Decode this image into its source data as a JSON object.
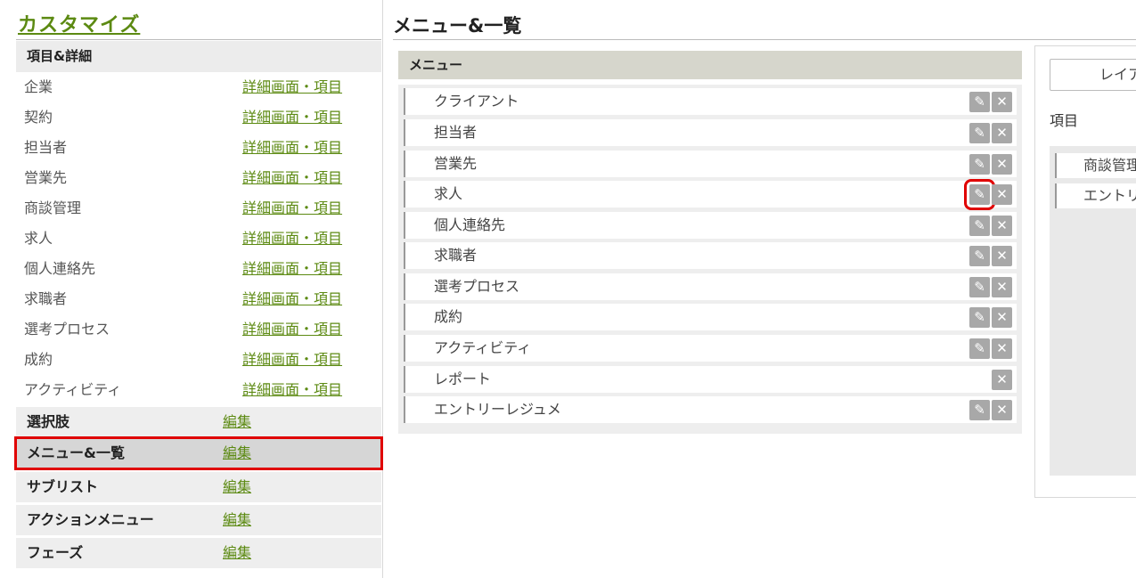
{
  "sidebar": {
    "title": "カスタマイズ",
    "section_items_details": "項目&詳細",
    "items": [
      {
        "label": "企業",
        "link": "詳細画面・項目"
      },
      {
        "label": "契約",
        "link": "詳細画面・項目"
      },
      {
        "label": "担当者",
        "link": "詳細画面・項目"
      },
      {
        "label": "営業先",
        "link": "詳細画面・項目"
      },
      {
        "label": "商談管理",
        "link": "詳細画面・項目"
      },
      {
        "label": "求人",
        "link": "詳細画面・項目"
      },
      {
        "label": "個人連絡先",
        "link": "詳細画面・項目"
      },
      {
        "label": "求職者",
        "link": "詳細画面・項目"
      },
      {
        "label": "選考プロセス",
        "link": "詳細画面・項目"
      },
      {
        "label": "成約",
        "link": "詳細画面・項目"
      },
      {
        "label": "アクティビティ",
        "link": "詳細画面・項目"
      }
    ],
    "sections": [
      {
        "label": "選択肢",
        "link": "編集"
      },
      {
        "label": "メニュー&一覧",
        "link": "編集",
        "active": true
      },
      {
        "label": "サブリスト",
        "link": "編集"
      },
      {
        "label": "アクションメニュー",
        "link": "編集"
      },
      {
        "label": "フェーズ",
        "link": "編集"
      }
    ]
  },
  "main": {
    "title": "メニュー&一覧",
    "menu_header": "メニュー",
    "menu_items": [
      {
        "label": "クライアント",
        "editable": true
      },
      {
        "label": "担当者",
        "editable": true
      },
      {
        "label": "営業先",
        "editable": true
      },
      {
        "label": "求人",
        "editable": true,
        "highlighted": true
      },
      {
        "label": "個人連絡先",
        "editable": true
      },
      {
        "label": "求職者",
        "editable": true
      },
      {
        "label": "選考プロセス",
        "editable": true
      },
      {
        "label": "成約",
        "editable": true
      },
      {
        "label": "アクティビティ",
        "editable": true
      },
      {
        "label": "レポート",
        "editable": false
      },
      {
        "label": "エントリーレジュメ",
        "editable": true
      }
    ],
    "edit_icon": "pencil-icon",
    "delete_icon": "close-icon"
  },
  "right_panel": {
    "layout_button": "レイア",
    "items_label": "項目",
    "items": [
      "商談管理",
      "エントリ"
    ]
  },
  "colors": {
    "accent": "#5c8a12",
    "highlight": "#e00000"
  }
}
